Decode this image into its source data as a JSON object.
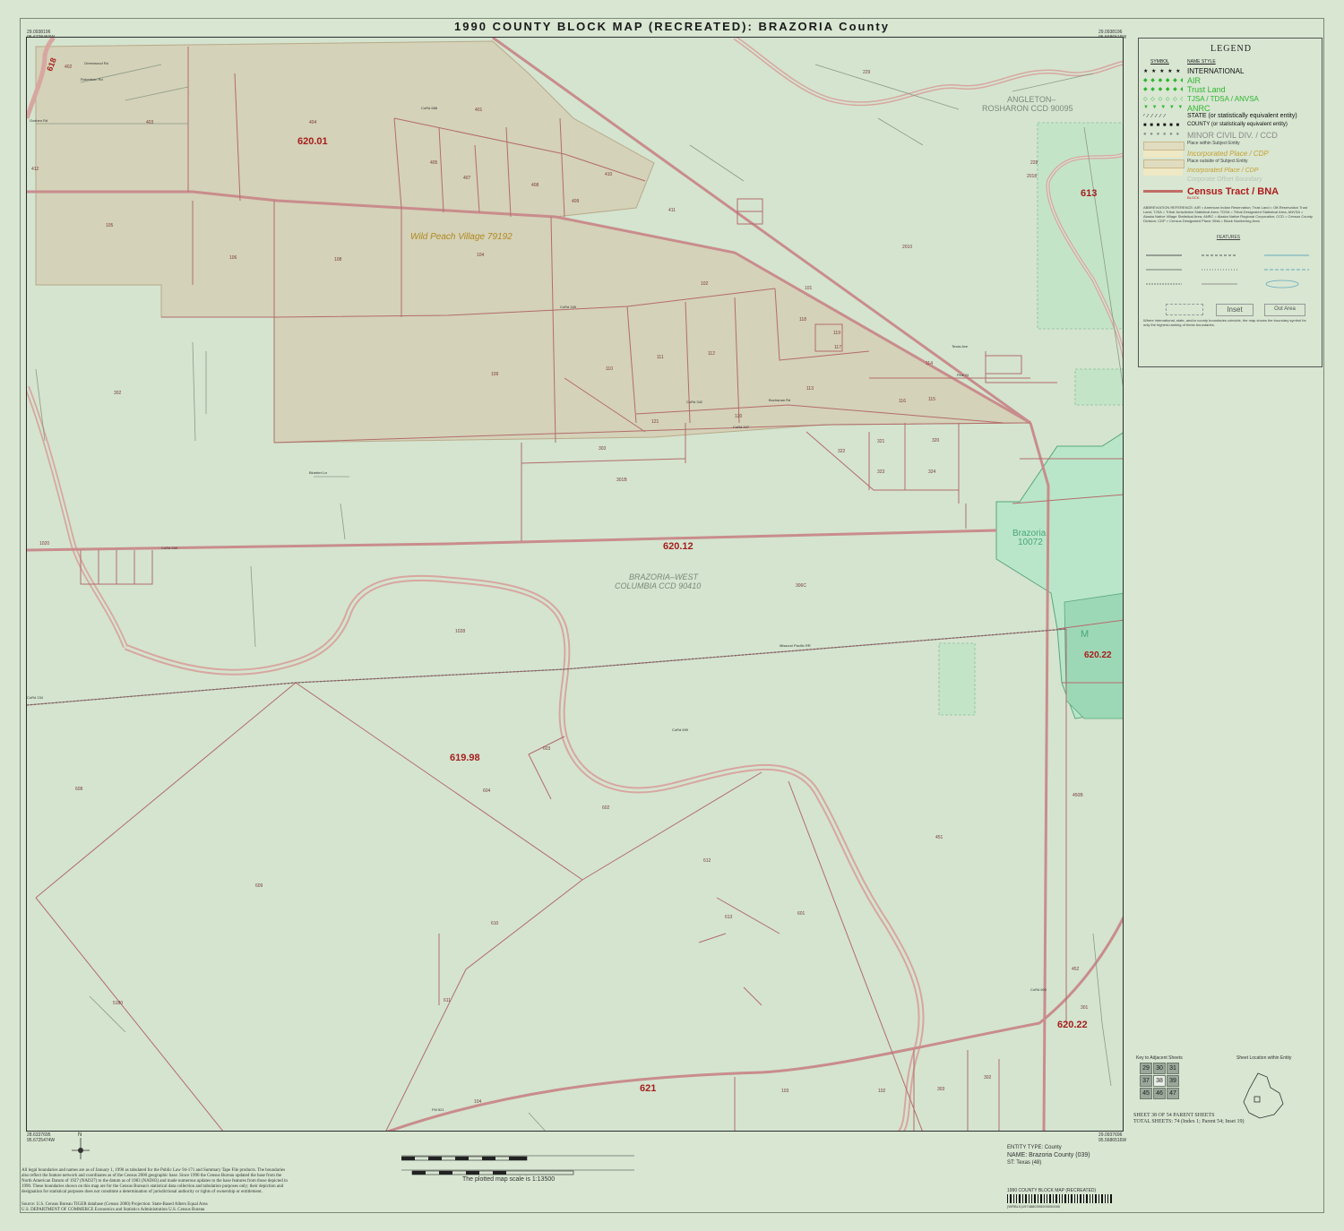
{
  "title": "1990 COUNTY BLOCK MAP (RECREATED): BRAZORIA County",
  "corner_coords": {
    "top_left": [
      "29.0938196",
      "95.6728450W"
    ],
    "top_right": [
      "29.0938196",
      "95.5686516W"
    ],
    "bottom_left": [
      "28.6337695",
      "95.6725474W"
    ],
    "bottom_right": [
      "29.0937696",
      "95.5686516W"
    ]
  },
  "tracts": [
    "620.01",
    "620.12",
    "619.98",
    "620.22",
    "620.22",
    "621",
    "613",
    "618"
  ],
  "places": {
    "wild_peach": "Wild Peach Village 79192",
    "brazoria_name": "Brazoria",
    "brazoria_code": "10072",
    "m_label": "M"
  },
  "ccds": {
    "angleton_1": "ANGLETON–",
    "angleton_2": "ROSHARON CCD 90095",
    "brazoria_west_1": "BRAZORIA–WEST",
    "brazoria_west_2": "COLUMBIA CCD 90410"
  },
  "blocks": [
    "404",
    "620.01",
    "405",
    "406",
    "407",
    "408",
    "409",
    "410",
    "411",
    "401",
    "402",
    "403",
    "412",
    "105",
    "106",
    "108",
    "104",
    "102",
    "101",
    "109",
    "110",
    "111",
    "112",
    "113",
    "114",
    "115",
    "116",
    "117",
    "118",
    "119",
    "120",
    "121",
    "303",
    "301B",
    "302",
    "320",
    "321",
    "322",
    "323",
    "324",
    "306C",
    "1020",
    "1028",
    "608",
    "609",
    "610",
    "611",
    "612",
    "613",
    "601",
    "602",
    "603",
    "604",
    "605",
    "451",
    "450B",
    "452",
    "301",
    "302",
    "303",
    "101",
    "102",
    "103",
    "104",
    "2010",
    "2018",
    "228",
    "229",
    "5180"
  ],
  "roads": [
    "Greenwood Rd",
    "Robertson Rd",
    "Goshen Rd",
    "CoRd 688",
    "CoRd 350",
    "CoRd 349",
    "CoRd 348",
    "CoRd 347",
    "CoRd 342",
    "CoRd 244",
    "CoRd 234",
    "CoRd 699",
    "CoRd 603",
    "CoRd 604",
    "CoRd 605",
    "Bingham Rd",
    "Bennett Rd",
    "Bluebird Ln",
    "Missouri Pacific RR",
    "Buchanan Rd",
    "Texas Ave",
    "Pine St",
    "CoRd 600",
    "FM 521"
  ],
  "legend": {
    "title": "LEGEND",
    "col_symbol": "SYMBOL",
    "col_name": "NAME STYLE",
    "items": [
      {
        "sym": "★ ★ ★ ★ ★ ★",
        "name": "INTERNATIONAL",
        "color": "#111111",
        "size": 8
      },
      {
        "sym": "◆ ◆ ◆ ◆ ◆ ◆",
        "name": "AIR",
        "color": "#2fb52f",
        "size": 9
      },
      {
        "sym": "◆ ◆ ◆ ◆ ◆ ◆",
        "name": "Trust Land",
        "color": "#2fb52f",
        "size": 9
      },
      {
        "sym": "◇ ◇ ◇ ◇ ◇ ◇",
        "name": "TJSA / TDSA / ANVSA",
        "color": "#2fb52f",
        "size": 8
      },
      {
        "sym": "▼ ▼ ▼ ▼ ▼ ▼",
        "name": "ANRC",
        "color": "#2fb52f",
        "size": 9
      },
      {
        "sym": "∕ ∕ ∕ ∕ ∕ ∕",
        "name": "STATE (or statistically equivalent entity)",
        "color": "#111111",
        "size": 7
      },
      {
        "sym": "■ ■ ■ ■ ■ ■",
        "name": "COUNTY (or statistically equivalent entity)",
        "color": "#111111",
        "size": 6
      },
      {
        "sym": "● ● ● ● ● ●",
        "name": "MINOR CIVIL DIV. / CCD",
        "color": "#8a8a8a",
        "size": 9
      },
      {
        "sym": "",
        "name": "Place within Subject Entity",
        "color": "#444444",
        "size": 5
      },
      {
        "sym": "",
        "name": "Incorporated Place / CDP",
        "color": "#c8a030",
        "size": 8
      },
      {
        "sym": "",
        "name": "Place outside of Subject Entity",
        "color": "#444444",
        "size": 5
      },
      {
        "sym": "",
        "name": "Incorporated Place / CDP",
        "color": "#c8a030",
        "size": 7
      },
      {
        "sym": "",
        "name": "Corporate Offset Boundary",
        "color": "#b8c4b4",
        "size": 7
      },
      {
        "sym": "",
        "name": "Census Tract / BNA",
        "color": "#b01c1c",
        "size": 11
      },
      {
        "sym": "",
        "name": "BLOCK",
        "color": "#b01c1c",
        "size": 4
      }
    ],
    "abbrev_title": "ABBREVIATION REFERENCE: AIR = American Indian Reservation; Trust Land = Off-Reservation Trust Land; TJSA = Tribal Jurisdiction Statistical Area; TDSA = Tribal Designated Statistical Area; ANVSA = Alaska Native Village Statistical Area; ANRC = Alaska Native Regional Corporation; CCD = Census County Division; CDP = Census Designated Place; BNA = Block Numbering Area",
    "features_title": "FEATURES",
    "inset_label": "Inset",
    "outarea_label": "Out Area",
    "note": "Where international, state, and/or county boundaries coincide, the map shows the boundary symbol for only the highest-ranking of these boundaries."
  },
  "key_title": "Key to Adjacent Sheets",
  "key_cells": [
    "29",
    "30",
    "31",
    "37",
    "38",
    "39",
    "45",
    "46",
    "47"
  ],
  "location_title": "Sheet Location within Entity",
  "sheet_info_1": "SHEET 38 OF 54 PARENT SHEETS",
  "sheet_info_2": "TOTAL SHEETS: 74 (Index 1; Parent 54; Inset 19)",
  "entity": {
    "type": "ENTITY TYPE: County",
    "name": "NAME: Brazoria County (039)",
    "st": "ST: Texas (48)"
  },
  "scale_text": "The plotted map scale is 1:13500",
  "barcode_title": "1990 COUNTY BLOCK MAP (RECREATED)",
  "barcode_number": "(WRBLK)1974880390000000000",
  "compass": "N",
  "footer_text": "All legal boundaries and names are as of January 1, 1990 as tabulated for the Public Law 94-171 and Summary Tape File products. The boundaries also reflect the feature network and coordinates as of the Census 2000 geographic base. Since 1990 the Census Bureau updated the base from the North American Datum of 1927 (NAD27) to the datum as of 1983 (NAD83) and made numerous updates to the base features from those depicted in 1990. These boundaries shown on this map are for the Census Bureau's statistical data collection and tabulation purposes only; their depiction and designation for statistical purposes does not constitute a determination of jurisdictional authority or rights of ownership or entitlement.",
  "footer_source": "Source: U.S. Census Bureau TIGER database (Census 2000)       Projection: State-Based Albers Equal Area",
  "footer_dept": "U.S. DEPARTMENT OF COMMERCE Economics and Statistics Administration U.S. Census Bureau",
  "colors": {
    "bg": "#d4e4cf",
    "place_fill": "#d4d2b8",
    "brazoria_fill": "#b9e6c9",
    "tract_line": "#c98c8c",
    "block_line": "#b36c6c",
    "river": "#d8a6a0",
    "tract_label": "#a51e1e",
    "place_label": "#b08820"
  }
}
